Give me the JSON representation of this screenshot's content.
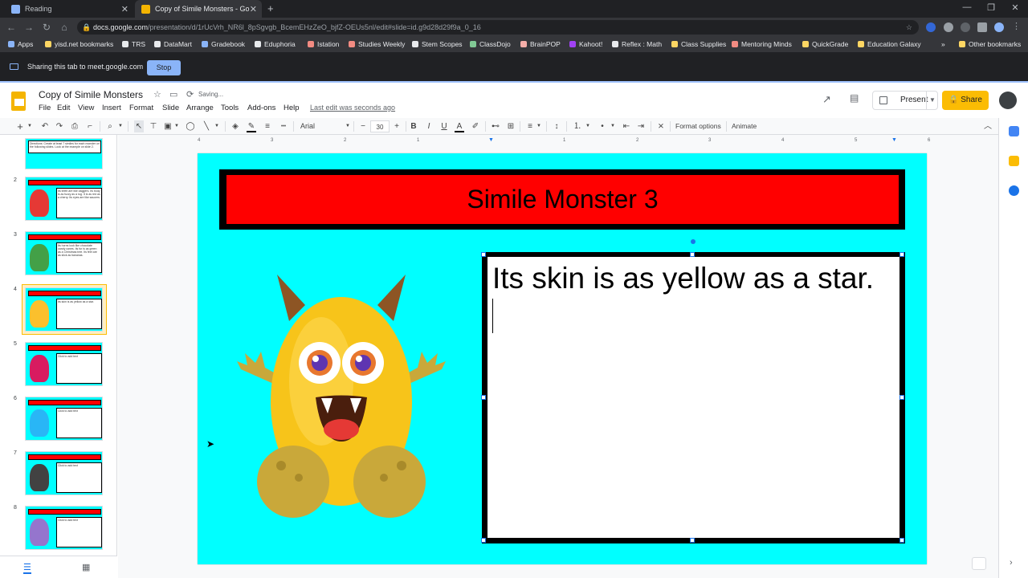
{
  "browser": {
    "tabs": [
      {
        "title": "Reading",
        "active": false
      },
      {
        "title": "Copy of Simile Monsters - Go",
        "active": true
      }
    ],
    "new_tab": "+",
    "url_domain": "docs.google.com",
    "url_path": "/presentation/d/1rUcVrh_NR6l_8pSgvgb_BcemEHzZeO_bjfZ-OEUs5nl/edit#slide=id.g9d28d29f9a_0_16",
    "bookmarks": [
      {
        "label": "Apps",
        "color": "#8ab4f8"
      },
      {
        "label": "yisd.net bookmarks",
        "color": "#fdd663"
      },
      {
        "label": "TRS",
        "color": "#e8eaed"
      },
      {
        "label": "DataMart",
        "color": "#e8eaed"
      },
      {
        "label": "Gradebook",
        "color": "#8ab4f8"
      },
      {
        "label": "Eduphoria",
        "color": "#e8eaed"
      },
      {
        "label": "Istation",
        "color": "#f28b82"
      },
      {
        "label": "Studies Weekly",
        "color": "#f28b82"
      },
      {
        "label": "Stem Scopes",
        "color": "#e8eaed"
      },
      {
        "label": "ClassDojo",
        "color": "#81c995"
      },
      {
        "label": "BrainPOP",
        "color": "#f6aea9"
      },
      {
        "label": "Kahoot!",
        "color": "#a142f4"
      },
      {
        "label": "Reflex : Math",
        "color": "#e8eaed"
      },
      {
        "label": "Class Supplies",
        "color": "#fdd663"
      },
      {
        "label": "Mentoring Minds",
        "color": "#f28b82"
      },
      {
        "label": "QuickGrade",
        "color": "#fdd663"
      },
      {
        "label": "Education Galaxy",
        "color": "#fdd663"
      }
    ],
    "more_bookmarks": "»",
    "other_bookmarks": "Other bookmarks",
    "sharing_text": "Sharing this tab to meet.google.com",
    "stop_label": "Stop"
  },
  "app": {
    "doc_title": "Copy of Simile Monsters",
    "saving": "Saving...",
    "menus": [
      "File",
      "Edit",
      "View",
      "Insert",
      "Format",
      "Slide",
      "Arrange",
      "Tools",
      "Add-ons",
      "Help"
    ],
    "last_edit": "Last edit was seconds ago",
    "present_label": "Present",
    "share_label": "Share"
  },
  "toolbar": {
    "font": "Arial",
    "font_size": "30",
    "format_options": "Format options",
    "animate": "Animate"
  },
  "filmstrip": {
    "partial_text": "Directions: Create at least 7 similes for each monster on the following slides. Look at the example on slide 2.",
    "slides": [
      {
        "num": "2",
        "text": "Its teeth are like daggers. Its body is as fuzzy as a rug. It is as red as a cherry. Its eyes are like saucers."
      },
      {
        "num": "3",
        "text": "Its horns look like chocolate candy canes. Its fur is as green as a Christmas tree. Its feet are as slick as bananas."
      },
      {
        "num": "4",
        "text": "Its skin is as yellow as a star."
      },
      {
        "num": "5",
        "text": "Click to add text"
      },
      {
        "num": "6",
        "text": "Click to add text"
      },
      {
        "num": "7",
        "text": "Click to add text"
      },
      {
        "num": "8",
        "text": "Click to add text"
      }
    ]
  },
  "slide": {
    "title": "Simile Monster 3",
    "body_text": "Its skin is as yellow as a star."
  },
  "ruler_marks": [
    "4",
    "3",
    "2",
    "1",
    "1",
    "2",
    "3",
    "4",
    "5",
    "6"
  ],
  "colors": {
    "slide_bg": "#00ffff",
    "title_band": "#ff0000",
    "share_button": "#fbbc04",
    "selection": "#1a73e8"
  }
}
